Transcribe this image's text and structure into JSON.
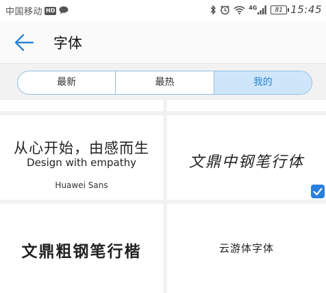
{
  "status_bar": {
    "carrier": "中国移动",
    "hd_badge": "HD",
    "network_type": "4G",
    "battery_level": "81",
    "time": "15:45",
    "icons": [
      "chat-icon",
      "bluetooth-icon",
      "alarm-icon",
      "wifi-icon",
      "signal-icon",
      "battery-icon"
    ]
  },
  "header": {
    "back_icon": "arrow-left-icon",
    "title": "字体"
  },
  "tabs": [
    {
      "label": "最新",
      "active": false
    },
    {
      "label": "最热",
      "active": false
    },
    {
      "label": "我的",
      "active": true
    }
  ],
  "fonts": [
    {
      "preview_line1": "从心开始，由感而生",
      "preview_line2": "Design with empathy",
      "name": "Huawei Sans"
    },
    {
      "preview": "文鼎中钢笔行体",
      "selected": true
    },
    {
      "preview": "文鼎粗钢笔行楷"
    },
    {
      "preview": "云游体字体"
    }
  ],
  "colors": {
    "accent": "#2a83d4",
    "tab_active_bg": "#cfe6fa",
    "tab_border": "#8fbfe6",
    "check_badge": "#2a7fde",
    "page_bg": "#f2f2f2"
  }
}
